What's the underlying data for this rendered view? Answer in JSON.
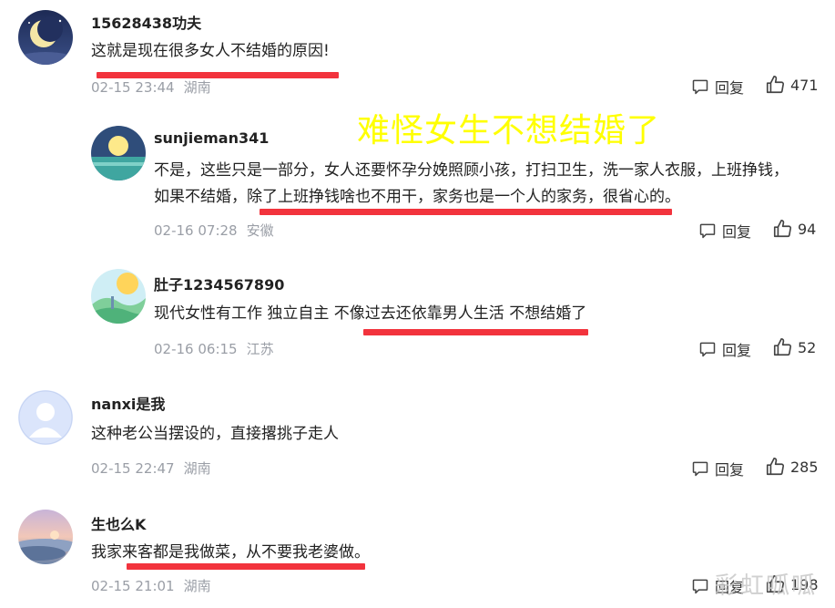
{
  "overlay_caption": "难怪女生不想结婚了",
  "watermark": "彩虹呱呱",
  "reply_label": "回复",
  "comments": [
    {
      "username": "15628438功夫",
      "lines": [
        "这就是现在很多女人不结婚的原因!"
      ],
      "date": "02-15 23:44",
      "location": "湖南",
      "likes": "471"
    },
    {
      "username": "sunjieman341",
      "lines": [
        "不是，这些只是一部分，女人还要怀孕分娩照顾小孩，打扫卫生，洗一家人衣服，上班挣钱，",
        "如果不结婚，除了上班挣钱啥也不用干，家务也是一个人的家务，很省心的。"
      ],
      "date": "02-16 07:28",
      "location": "安徽",
      "likes": "94"
    },
    {
      "username": "肚子1234567890",
      "lines": [
        "现代女性有工作 独立自主 不像过去还依靠男人生活 不想结婚了"
      ],
      "date": "02-16 06:15",
      "location": "江苏",
      "likes": "52"
    },
    {
      "username": "nanxi是我",
      "lines": [
        "这种老公当摆设的，直接撂挑子走人"
      ],
      "date": "02-15 22:47",
      "location": "湖南",
      "likes": "285"
    },
    {
      "username": "生也么K",
      "lines": [
        "我家来客都是我做菜，从不要我老婆做。"
      ],
      "date": "02-15 21:01",
      "location": "湖南",
      "likes": "198"
    }
  ]
}
